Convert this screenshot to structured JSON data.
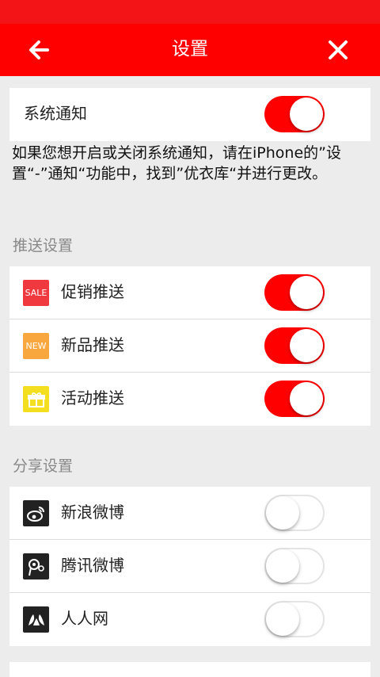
{
  "nav": {
    "title": "设置"
  },
  "system_notice": {
    "label": "系统通知",
    "enabled": true
  },
  "note": "如果您想开启或关闭系统通知，请在iPhone的”设置“-”通知“功能中，找到”优衣库“并进行更改。",
  "push": {
    "section_title": "推送设置",
    "items": [
      {
        "label": "促销推送",
        "icon": "sale-icon",
        "icon_text": "SALE",
        "enabled": true
      },
      {
        "label": "新品推送",
        "icon": "new-icon",
        "icon_text": "NEW",
        "enabled": true
      },
      {
        "label": "活动推送",
        "icon": "gift-icon",
        "enabled": true
      }
    ]
  },
  "share": {
    "section_title": "分享设置",
    "items": [
      {
        "label": "新浪微博",
        "icon": "sina-weibo-icon",
        "enabled": false
      },
      {
        "label": "腾讯微博",
        "icon": "tencent-weibo-icon",
        "enabled": false
      },
      {
        "label": "人人网",
        "icon": "renren-icon",
        "enabled": false
      }
    ]
  },
  "colors": {
    "accent": "#ff0000",
    "status_bar": "#f21417",
    "background": "#ececec"
  }
}
